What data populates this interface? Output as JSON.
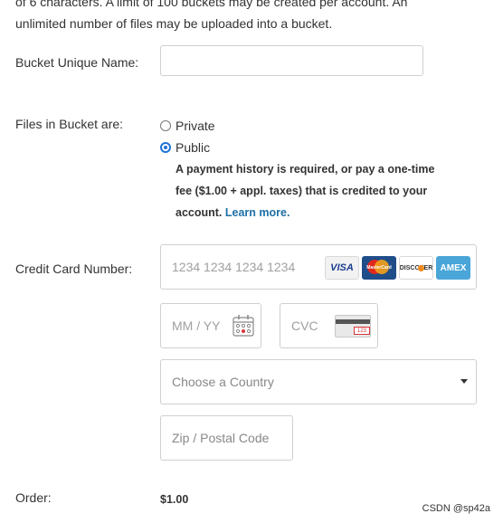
{
  "intro": {
    "line1": "of 6 characters. A limit of 100 buckets may be created per account. An",
    "line2": "unlimited number of files may be uploaded into a bucket."
  },
  "bucket_name": {
    "label": "Bucket Unique Name:",
    "value": ""
  },
  "files_access": {
    "label": "Files in Bucket are:",
    "options": [
      {
        "label": "Private",
        "selected": false
      },
      {
        "label": "Public",
        "selected": true
      }
    ],
    "note_line1": "A payment history is required, or pay a one-time",
    "note_line2": "fee ($1.00 + appl. taxes) that is credited to your",
    "note_line3": "account.",
    "learn_more": "Learn more."
  },
  "credit_card": {
    "label": "Credit Card Number:",
    "number_placeholder": "1234 1234 1234 1234",
    "cards": [
      {
        "name": "visa-icon",
        "text": "VISA"
      },
      {
        "name": "mastercard-icon",
        "text": "MasterCard"
      },
      {
        "name": "discover-icon",
        "text": "DISCOVER"
      },
      {
        "name": "amex-icon",
        "text": "AMEX"
      }
    ],
    "expiry_placeholder": "MM / YY",
    "cvc_placeholder": "CVC",
    "cvc_sample": "123",
    "country_placeholder": "Choose a Country",
    "zip_placeholder": "Zip / Postal Code"
  },
  "order": {
    "label": "Order:",
    "amount": "$1.00"
  },
  "watermark": "CSDN @sp42a"
}
